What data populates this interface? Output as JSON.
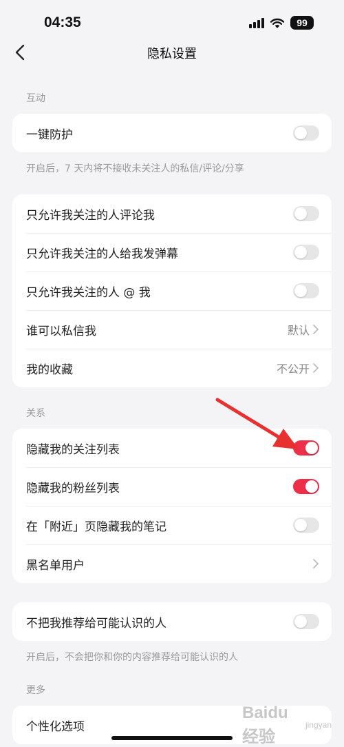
{
  "status_bar": {
    "time": "04:35",
    "battery": "99"
  },
  "nav": {
    "title": "隐私设置"
  },
  "sections": {
    "interaction": "互动",
    "relations": "关系",
    "more": "更多"
  },
  "one_key_protect": {
    "label": "一键防护",
    "enabled": false,
    "hint": "开启后，7 天内将不接收未关注人的私信/评论/分享"
  },
  "interaction_items": [
    {
      "label": "只允许我关注的人评论我",
      "enabled": false
    },
    {
      "label": "只允许我关注的人给我发弹幕",
      "enabled": false
    },
    {
      "label": "只允许我关注的人 @ 我",
      "enabled": false
    },
    {
      "label": "谁可以私信我",
      "value": "默认"
    },
    {
      "label": "我的收藏",
      "value": "不公开"
    }
  ],
  "relation_items": [
    {
      "label": "隐藏我的关注列表",
      "enabled": true
    },
    {
      "label": "隐藏我的粉丝列表",
      "enabled": true
    },
    {
      "label": "在「附近」页隐藏我的笔记",
      "enabled": false
    },
    {
      "label": "黑名单用户"
    }
  ],
  "recommend": {
    "label": "不把我推荐给可能认识的人",
    "enabled": false,
    "hint": "开启后，不会把你和你的内容推荐给可能认识的人"
  },
  "more_items": [
    {
      "label": "个性化选项"
    }
  ],
  "watermark": {
    "text": "Baidu经验",
    "sub": "jingyan"
  },
  "colors": {
    "accent": "#ee2f4a",
    "arrow": "#e8302f",
    "background": "#f4f4f6"
  }
}
